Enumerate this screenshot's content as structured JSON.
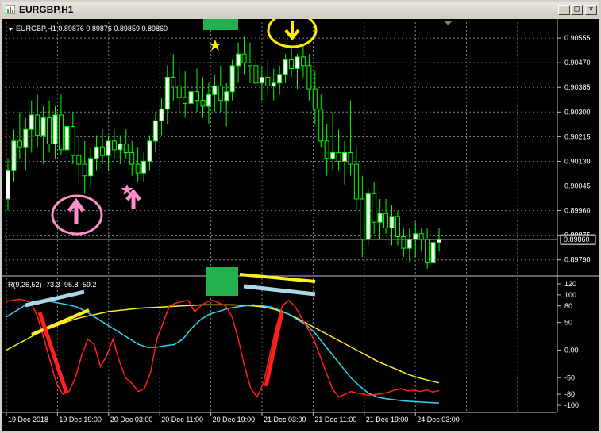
{
  "window": {
    "title": "EURGBP,H1",
    "buttons": [
      "_",
      "□",
      "×"
    ]
  },
  "main_panel": {
    "header": "EURGBP,H1  0.89876 0.89876 0.89859 0.89860",
    "price_labels": [
      "0.90555",
      "0.90470",
      "0.90385",
      "0.90300",
      "0.90215",
      "0.90130",
      "0.90045",
      "0.89960",
      "0.89875",
      "0.89790"
    ],
    "current_price": "0.89860",
    "current_price_color": "#ffffff"
  },
  "indicator_panel": {
    "header": "R(9,26,52) -73.3 -95.8 -59.2",
    "levels": [
      "120",
      "100",
      "80",
      "50",
      "0.00",
      "-50",
      "-80",
      "-100"
    ]
  },
  "time_labels": [
    "19 Dec 2018",
    "19 Dec 19:00",
    "20 Dec 03:00",
    "20 Dec 11:00",
    "20 Dec 19:00",
    "21 Dec 03:00",
    "21 Dec 11:00",
    "21 Dec 19:00",
    "24 Dec 03:00"
  ],
  "colors": {
    "background": "#000000",
    "bull_candle": "#ffffff",
    "bear_candle": "#000000",
    "wick": "#00ff00",
    "grid": "#808080",
    "fast_line": "#ff2020",
    "mid_line": "#33d6ee",
    "slow_line": "#ffee22",
    "marker_green": "#23b14d",
    "pink": "#ff8fc8",
    "yellow": "#ffee00",
    "light_blue": "#a8d8ea"
  },
  "chart_data": {
    "type": "candlestick",
    "symbol": "EURGBP",
    "timeframe": "H1",
    "ohlc": [
      [
        0.9,
        0.9014,
        0.8996,
        0.901
      ],
      [
        0.901,
        0.9024,
        0.9006,
        0.902
      ],
      [
        0.902,
        0.903,
        0.9014,
        0.9018
      ],
      [
        0.9018,
        0.9028,
        0.901,
        0.9024
      ],
      [
        0.9024,
        0.9034,
        0.9016,
        0.9029
      ],
      [
        0.9029,
        0.9036,
        0.9018,
        0.9022
      ],
      [
        0.9022,
        0.9032,
        0.9012,
        0.9028
      ],
      [
        0.9028,
        0.9034,
        0.9016,
        0.9019
      ],
      [
        0.9019,
        0.9032,
        0.9014,
        0.9029
      ],
      [
        0.9029,
        0.9036,
        0.9015,
        0.9017
      ],
      [
        0.9017,
        0.903,
        0.901,
        0.9025
      ],
      [
        0.9025,
        0.903,
        0.9012,
        0.9015
      ],
      [
        0.9015,
        0.9022,
        0.9006,
        0.9012
      ],
      [
        0.9012,
        0.902,
        0.9002,
        0.9008
      ],
      [
        0.9008,
        0.9018,
        0.9004,
        0.9014
      ],
      [
        0.9014,
        0.9022,
        0.901,
        0.9018
      ],
      [
        0.9018,
        0.9024,
        0.9012,
        0.9015
      ],
      [
        0.9015,
        0.9022,
        0.901,
        0.902
      ],
      [
        0.902,
        0.9024,
        0.9014,
        0.9017
      ],
      [
        0.9017,
        0.9022,
        0.9012,
        0.9019
      ],
      [
        0.9019,
        0.9024,
        0.9014,
        0.9016
      ],
      [
        0.9016,
        0.902,
        0.9008,
        0.9012
      ],
      [
        0.9012,
        0.9018,
        0.9006,
        0.9009
      ],
      [
        0.9009,
        0.9016,
        0.9006,
        0.9013
      ],
      [
        0.9013,
        0.9022,
        0.901,
        0.902
      ],
      [
        0.902,
        0.903,
        0.9016,
        0.9027
      ],
      [
        0.9027,
        0.9035,
        0.9022,
        0.9031
      ],
      [
        0.9031,
        0.9046,
        0.9026,
        0.9042
      ],
      [
        0.9042,
        0.905,
        0.9034,
        0.9039
      ],
      [
        0.9039,
        0.9046,
        0.903,
        0.9035
      ],
      [
        0.9035,
        0.9044,
        0.9028,
        0.9033
      ],
      [
        0.9033,
        0.904,
        0.9026,
        0.9037
      ],
      [
        0.9037,
        0.9045,
        0.903,
        0.9034
      ],
      [
        0.9034,
        0.9042,
        0.9028,
        0.9032
      ],
      [
        0.9032,
        0.904,
        0.9026,
        0.9036
      ],
      [
        0.9036,
        0.9043,
        0.903,
        0.9039
      ],
      [
        0.9039,
        0.9046,
        0.903,
        0.9034
      ],
      [
        0.9034,
        0.904,
        0.9025,
        0.9037
      ],
      [
        0.9037,
        0.9048,
        0.9034,
        0.9046
      ],
      [
        0.9046,
        0.9054,
        0.904,
        0.905
      ],
      [
        0.905,
        0.9056,
        0.9043,
        0.9047
      ],
      [
        0.9047,
        0.9054,
        0.904,
        0.9046
      ],
      [
        0.9046,
        0.905,
        0.9038,
        0.904
      ],
      [
        0.904,
        0.9046,
        0.9034,
        0.9042
      ],
      [
        0.9042,
        0.9048,
        0.9036,
        0.9039
      ],
      [
        0.9039,
        0.9045,
        0.9034,
        0.904
      ],
      [
        0.904,
        0.9046,
        0.9036,
        0.9043
      ],
      [
        0.9043,
        0.905,
        0.904,
        0.9048
      ],
      [
        0.9048,
        0.9052,
        0.9042,
        0.9045
      ],
      [
        0.9045,
        0.905,
        0.9038,
        0.9049
      ],
      [
        0.9049,
        0.9053,
        0.9042,
        0.9046
      ],
      [
        0.9046,
        0.905,
        0.9034,
        0.9038
      ],
      [
        0.9038,
        0.9044,
        0.9026,
        0.9031
      ],
      [
        0.9031,
        0.9036,
        0.9018,
        0.902
      ],
      [
        0.902,
        0.9026,
        0.9008,
        0.9014
      ],
      [
        0.9014,
        0.903,
        0.901,
        0.9016
      ],
      [
        0.9016,
        0.9024,
        0.901,
        0.9013
      ],
      [
        0.9013,
        0.902,
        0.9005,
        0.9016
      ],
      [
        0.9016,
        0.9034,
        0.9008,
        0.9012
      ],
      [
        0.9012,
        0.9018,
        0.8996,
        0.9
      ],
      [
        0.9,
        0.9008,
        0.898,
        0.8986
      ],
      [
        0.8986,
        0.9004,
        0.8984,
        0.9002
      ],
      [
        0.9002,
        0.9006,
        0.8988,
        0.8992
      ],
      [
        0.8992,
        0.9,
        0.8986,
        0.8995
      ],
      [
        0.8995,
        0.9,
        0.8988,
        0.899
      ],
      [
        0.899,
        0.8998,
        0.8984,
        0.8994
      ],
      [
        0.8994,
        0.8996,
        0.8984,
        0.8987
      ],
      [
        0.8987,
        0.899,
        0.898,
        0.8983
      ],
      [
        0.8983,
        0.899,
        0.8978,
        0.8986
      ],
      [
        0.8986,
        0.8992,
        0.898,
        0.8988
      ],
      [
        0.8988,
        0.899,
        0.8982,
        0.8986
      ],
      [
        0.8986,
        0.899,
        0.8976,
        0.8978
      ],
      [
        0.8978,
        0.8988,
        0.8976,
        0.8985
      ],
      [
        0.8985,
        0.899,
        0.8982,
        0.8986
      ]
    ],
    "price_range": [
      0.8974,
      0.9061
    ],
    "current_price": 0.8986,
    "indicator": {
      "name": "R(9,26,52)",
      "values_now": [
        -73.3,
        -95.8,
        -59.2
      ],
      "range": [
        -110,
        130
      ],
      "fast": [
        88,
        90,
        92,
        90,
        85,
        60,
        20,
        -20,
        -60,
        -80,
        -75,
        -50,
        -10,
        20,
        10,
        -30,
        -10,
        20,
        -20,
        -50,
        -60,
        -75,
        -70,
        -40,
        20,
        50,
        80,
        85,
        88,
        90,
        70,
        80,
        88,
        90,
        85,
        80,
        60,
        20,
        -30,
        -70,
        -85,
        -60,
        -10,
        40,
        80,
        90,
        80,
        60,
        40,
        20,
        -10,
        -40,
        -70,
        -85,
        -80,
        -75,
        -78,
        -80,
        -82,
        -80,
        -79,
        -76,
        -72,
        -70,
        -74,
        -73,
        -75,
        -72,
        -76,
        -73
      ],
      "mid": [
        60,
        70,
        80,
        88,
        90,
        88,
        85,
        82,
        78,
        70,
        60,
        50,
        40,
        30,
        20,
        10,
        5,
        5,
        8,
        10,
        20,
        40,
        55,
        65,
        70,
        75,
        78,
        80,
        82,
        80,
        78,
        72,
        65,
        55,
        45,
        30,
        10,
        -10,
        -30,
        -50,
        -65,
        -78,
        -85,
        -88,
        -90,
        -92,
        -93,
        -94,
        -95,
        -95.8
      ],
      "slow": [
        0,
        10,
        20,
        30,
        38,
        45,
        52,
        58,
        62,
        66,
        70,
        72,
        74,
        76,
        77,
        78,
        79,
        80,
        81,
        82,
        82,
        82,
        82,
        81,
        80,
        78,
        74,
        68,
        60,
        50,
        40,
        30,
        20,
        10,
        0,
        -10,
        -20,
        -28,
        -36,
        -44,
        -50,
        -55,
        -59.2
      ]
    }
  }
}
